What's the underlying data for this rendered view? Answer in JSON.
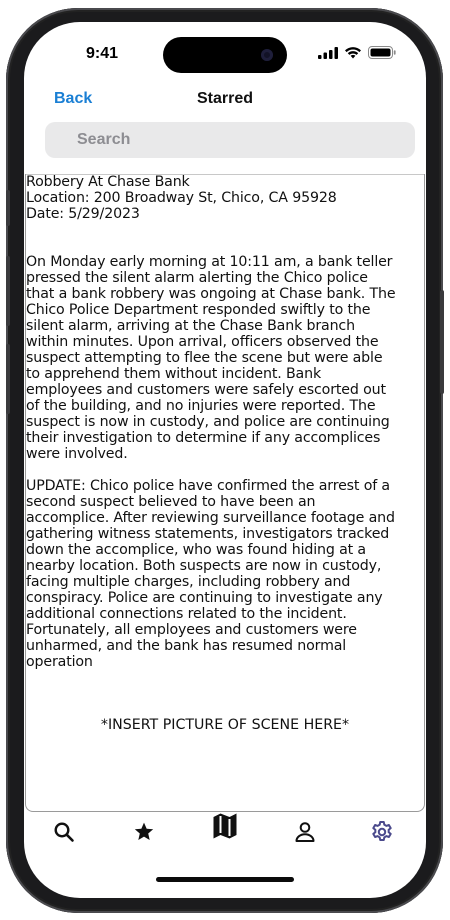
{
  "status_bar": {
    "time": "9:41"
  },
  "nav": {
    "back_label": "Back",
    "title": "Starred"
  },
  "search": {
    "placeholder": "Search"
  },
  "article": {
    "title": "Robbery At Chase Bank",
    "location": "Location: 200 Broadway St, Chico, CA 95928",
    "date": "Date: 5/29/2023",
    "paragraph1": "On Monday early morning at 10:11 am, a bank teller\npressed the silent alarm alerting the Chico police\nthat a bank robbery was ongoing at Chase bank. The\nChico Police Department responded swiftly to the\nsilent alarm, arriving at the Chase Bank branch\nwithin minutes. Upon arrival, officers observed the\nsuspect attempting to flee the scene but were able\nto apprehend them without incident. Bank\nemployees and customers were safely escorted out\nof the building, and no injuries were reported. The\nsuspect is now in custody, and police are continuing\ntheir investigation to determine if any accomplices\nwere involved.",
    "paragraph2": "UPDATE: Chico police have confirmed the arrest of a\nsecond suspect believed to have been an\naccomplice. After reviewing surveillance footage and\ngathering witness statements, investigators tracked\ndown the accomplice, who was found hiding at a\nnearby location. Both suspects are now in custody,\nfacing multiple charges, including robbery and\nconspiracy. Police are continuing to investigate any\nadditional connections related to the incident.\nFortunately, all employees and customers were\nunharmed, and the bank has resumed normal\noperation",
    "picture_placeholder": "*INSERT PICTURE OF SCENE HERE*"
  },
  "tab_bar": {
    "tabs": [
      {
        "icon": "search-icon"
      },
      {
        "icon": "star-icon"
      },
      {
        "icon": "map-icon"
      },
      {
        "icon": "person-icon"
      },
      {
        "icon": "gear-icon",
        "active": true
      }
    ],
    "active_color": "#4b4a8c"
  },
  "colors": {
    "link": "#1a7fd4",
    "search_bg": "#e9e9ea",
    "frame": "#1b1b1d"
  }
}
